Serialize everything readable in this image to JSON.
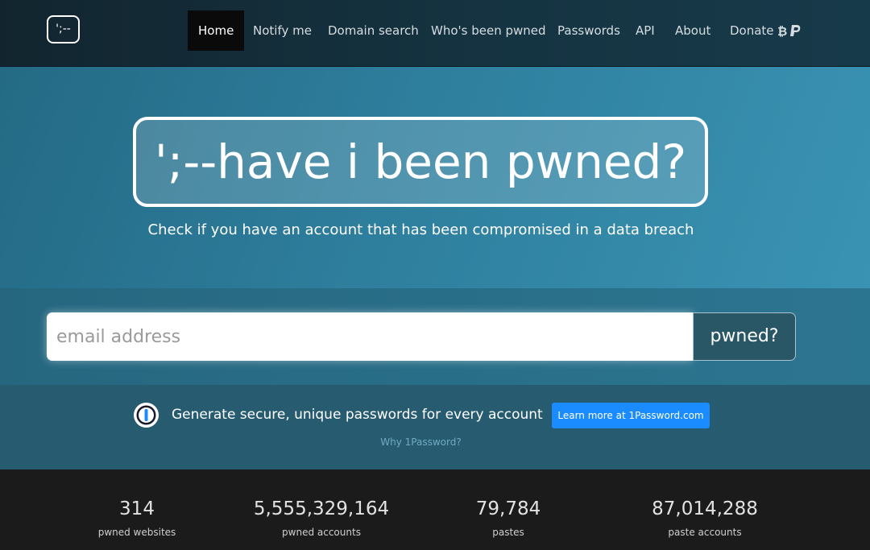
{
  "nav": {
    "logo_text": "';--",
    "items": [
      {
        "label": "Home",
        "active": true
      },
      {
        "label": "Notify me"
      },
      {
        "label": "Domain search"
      },
      {
        "label": "Who's been pwned"
      },
      {
        "label": "Passwords"
      },
      {
        "label": "API"
      },
      {
        "label": "About"
      },
      {
        "label": "Donate",
        "icons": [
          "bitcoin-icon",
          "paypal-icon"
        ]
      }
    ]
  },
  "hero": {
    "title": "';--have i been pwned?",
    "subtitle": "Check if you have an account that has been compromised in a data breach"
  },
  "search": {
    "placeholder": "email address",
    "value": "",
    "button_label": "pwned?"
  },
  "promo": {
    "icon": "1password-icon",
    "text": "Generate secure, unique passwords for every account",
    "button_label": "Learn more at 1Password.com",
    "link_label": "Why 1Password?"
  },
  "stats": [
    {
      "value": "314",
      "label": "pwned websites"
    },
    {
      "value": "5,555,329,164",
      "label": "pwned accounts"
    },
    {
      "value": "79,784",
      "label": "pastes"
    },
    {
      "value": "87,014,288",
      "label": "paste accounts"
    }
  ],
  "colors": {
    "accent_button": "#1a8cff",
    "hero_bg": "#2e7e9d",
    "nav_bg": "#153341",
    "search_button_bg": "#2a5766",
    "stats_bg": "#1b1b1b"
  }
}
